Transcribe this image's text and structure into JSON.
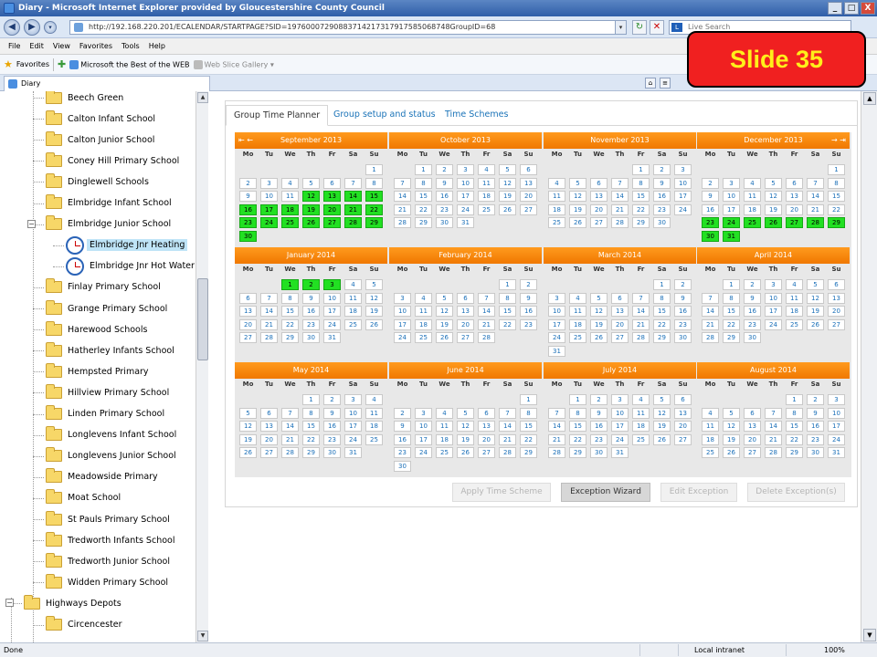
{
  "window": {
    "title": "Diary - Microsoft Internet Explorer provided by Gloucestershire County Council",
    "minimize": "_",
    "maximize": "□",
    "close": "X"
  },
  "address": {
    "url": "http://192.168.220.201/ECALENDAR/STARTPAGE?SID=19760007290883714217317917585068748GroupID=68",
    "search_placeholder": "Live Search",
    "search_brand": "L"
  },
  "menu": [
    "File",
    "Edit",
    "View",
    "Favorites",
    "Tools",
    "Help"
  ],
  "favorites": {
    "label": "Favorites",
    "item1": "Microsoft the Best of the WEB",
    "item2": "Web Slice Gallery"
  },
  "browser_tab": "Diary",
  "slide_label": "Slide 35",
  "tree": [
    {
      "label": "Beech Green",
      "type": "folder",
      "level": 1
    },
    {
      "label": "Calton Infant School",
      "type": "folder",
      "level": 1
    },
    {
      "label": "Calton Junior School",
      "type": "folder",
      "level": 1
    },
    {
      "label": "Coney Hill Primary School",
      "type": "folder",
      "level": 1
    },
    {
      "label": "Dinglewell Schools",
      "type": "folder",
      "level": 1
    },
    {
      "label": "Elmbridge Infant School",
      "type": "folder",
      "level": 1
    },
    {
      "label": "Elmbridge Junior School",
      "type": "folder",
      "level": 1,
      "expanded": true
    },
    {
      "label": "Elmbridge Jnr Heating",
      "type": "clock",
      "level": 2,
      "selected": true
    },
    {
      "label": "Elmbridge Jnr Hot Water",
      "type": "clock",
      "level": 2
    },
    {
      "label": "Finlay Primary School",
      "type": "folder",
      "level": 1
    },
    {
      "label": "Grange Primary School",
      "type": "folder",
      "level": 1
    },
    {
      "label": "Harewood Schools",
      "type": "folder",
      "level": 1
    },
    {
      "label": "Hatherley Infants School",
      "type": "folder",
      "level": 1
    },
    {
      "label": "Hempsted Primary",
      "type": "folder",
      "level": 1
    },
    {
      "label": "Hillview Primary School",
      "type": "folder",
      "level": 1
    },
    {
      "label": "Linden Primary School",
      "type": "folder",
      "level": 1
    },
    {
      "label": "Longlevens Infant School",
      "type": "folder",
      "level": 1
    },
    {
      "label": "Longlevens Junior School",
      "type": "folder",
      "level": 1
    },
    {
      "label": "Meadowside Primary",
      "type": "folder",
      "level": 1
    },
    {
      "label": "Moat School",
      "type": "folder",
      "level": 1
    },
    {
      "label": "St Pauls Primary School",
      "type": "folder",
      "level": 1
    },
    {
      "label": "Tredworth Infants School",
      "type": "folder",
      "level": 1
    },
    {
      "label": "Tredworth Junior School",
      "type": "folder",
      "level": 1
    },
    {
      "label": "Widden Primary School",
      "type": "folder",
      "level": 1
    },
    {
      "label": "Highways Depots",
      "type": "folder",
      "level": 0,
      "expanded": true
    },
    {
      "label": "Circencester",
      "type": "folder",
      "level": 1
    }
  ],
  "panel_tabs": [
    "Group Time Planner",
    "Group setup and status",
    "Time Schemes"
  ],
  "weekdays": [
    "Mo",
    "Tu",
    "We",
    "Th",
    "Fr",
    "Sa",
    "Su"
  ],
  "nav": {
    "first": "⇤",
    "prev": "←",
    "next": "→",
    "last": "⇥"
  },
  "months": [
    {
      "name": "September 2013",
      "offset": 6,
      "days": 30,
      "exceptions": [
        12,
        13,
        14,
        15,
        16,
        17,
        18,
        19,
        20,
        21,
        22,
        23,
        24,
        25,
        26,
        27,
        28,
        29,
        30
      ]
    },
    {
      "name": "October 2013",
      "offset": 1,
      "days": 31,
      "exceptions": []
    },
    {
      "name": "November 2013",
      "offset": 4,
      "days": 30,
      "exceptions": []
    },
    {
      "name": "December 2013",
      "offset": 6,
      "days": 31,
      "exceptions": [
        23,
        24,
        25,
        26,
        27,
        28,
        29,
        30,
        31
      ]
    },
    {
      "name": "January 2014",
      "offset": 2,
      "days": 31,
      "exceptions": [
        1,
        2,
        3
      ]
    },
    {
      "name": "February 2014",
      "offset": 5,
      "days": 28,
      "exceptions": []
    },
    {
      "name": "March 2014",
      "offset": 5,
      "days": 31,
      "exceptions": []
    },
    {
      "name": "April 2014",
      "offset": 1,
      "days": 30,
      "exceptions": []
    },
    {
      "name": "May 2014",
      "offset": 3,
      "days": 31,
      "exceptions": []
    },
    {
      "name": "June 2014",
      "offset": 6,
      "days": 30,
      "exceptions": []
    },
    {
      "name": "July 2014",
      "offset": 1,
      "days": 31,
      "exceptions": []
    },
    {
      "name": "August 2014",
      "offset": 4,
      "days": 31,
      "exceptions": []
    }
  ],
  "buttons": {
    "apply": "Apply Time Scheme",
    "wizard": "Exception Wizard",
    "edit": "Edit Exception",
    "delete": "Delete Exception(s)"
  },
  "status": {
    "left": "Done",
    "zone": "Local intranet",
    "zoom": "100%"
  },
  "colors": {
    "accent_orange": "#f07800",
    "exception_green": "#22e022",
    "link_blue": "#1a73b8"
  }
}
